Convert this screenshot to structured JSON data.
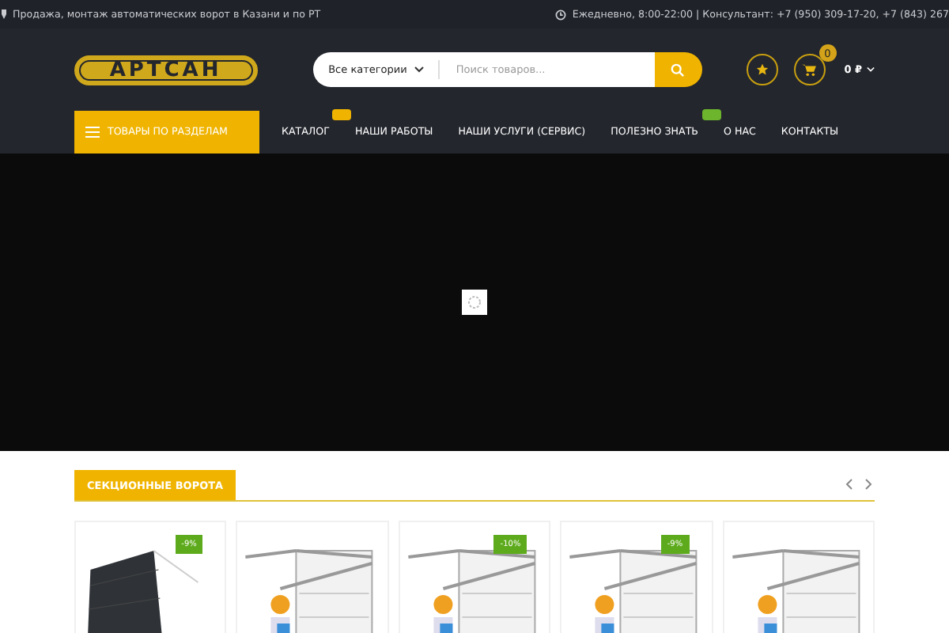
{
  "top_bar": {
    "left_text": "Продажа, монтаж автоматических ворот в Казани и по РТ",
    "right_text": "Ежедневно, 8:00-22:00 | Консультант: +7 (950) 309-17-20, +7 (843) 267"
  },
  "header": {
    "logo": "АРТСАН",
    "category_select": "Все категории",
    "search": {
      "placeholder": "Поиск товаров..."
    },
    "cart_count": "0",
    "cart_total": "0 ₽"
  },
  "nav": {
    "categories_button": "ТОВАРЫ ПО РАЗДЕЛАМ",
    "items": [
      {
        "label": "КАТАЛОГ",
        "color": "#f0b400"
      },
      {
        "label": "НАШИ РАБОТЫ"
      },
      {
        "label": "НАШИ УСЛУГИ (СЕРВИС)"
      },
      {
        "label": "ПОЛЕЗНО ЗНАТЬ",
        "color": "#6cb52d"
      },
      {
        "label": "О НАС"
      },
      {
        "label": "КОНТАКТЫ"
      }
    ]
  },
  "slider": {
    "loading": true
  },
  "section": {
    "title": "СЕКЦИОННЫЕ ВОРОТА",
    "products": [
      {
        "kind": "panel",
        "discount": "-9%"
      },
      {
        "kind": "frame"
      },
      {
        "kind": "frame",
        "discount": "-10%"
      },
      {
        "kind": "frame",
        "discount": "-9%"
      },
      {
        "kind": "frame"
      }
    ]
  }
}
